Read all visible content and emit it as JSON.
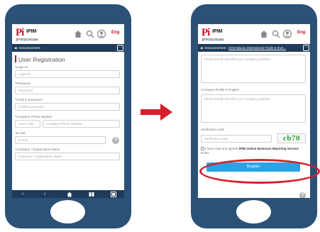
{
  "header": {
    "logo_mark": "Pi",
    "logo_name": "IPIM",
    "logo_sub": "澳門貿易投資促進局",
    "lang": "Eng",
    "icons": [
      "home-icon",
      "search-icon",
      "user-icon",
      "lang-icon"
    ]
  },
  "left": {
    "announcement": "Announcement :",
    "title": "User Registration",
    "fields": [
      {
        "label": "Login ID",
        "placeholder": "Login ID"
      },
      {
        "label": "Password",
        "placeholder": "Password"
      },
      {
        "label": "Confirm password",
        "placeholder": "Confirm password"
      },
      {
        "label": "Company Phone Number",
        "area_placeholder": "Area Code",
        "placeholder": "Company Phone Number"
      },
      {
        "label": "E-mail",
        "placeholder": "E-mail"
      },
      {
        "label": "Company / Organization Name",
        "placeholder": "Company / Organization Name"
      }
    ],
    "nav_icons": [
      "back-icon",
      "forward-icon",
      "home-icon",
      "book-icon",
      "menu-icon"
    ]
  },
  "right": {
    "announcement": "Announcement :",
    "announcement_link": "22'at Macau International Trade & Inve...",
    "textarea1_placeholder": "Please briefly describe your company activities",
    "profile_label": "Company Profile in English",
    "textarea2_placeholder": "Please briefly describe your company activities",
    "verification_label": "Verification code",
    "verification_placeholder": "Verification code",
    "captcha": "cb70",
    "agree_text_pre": "I have read and agreed",
    "agree_text_bold": "IPIM Online Business Matching Service",
    "agree_text_post": "Rules",
    "register_label": "Register"
  },
  "colors": {
    "phone": "#2b5276",
    "accent": "#c8102e",
    "register": "#29a3e8",
    "highlight": "#d6202a",
    "arrow": "#d6202a"
  }
}
